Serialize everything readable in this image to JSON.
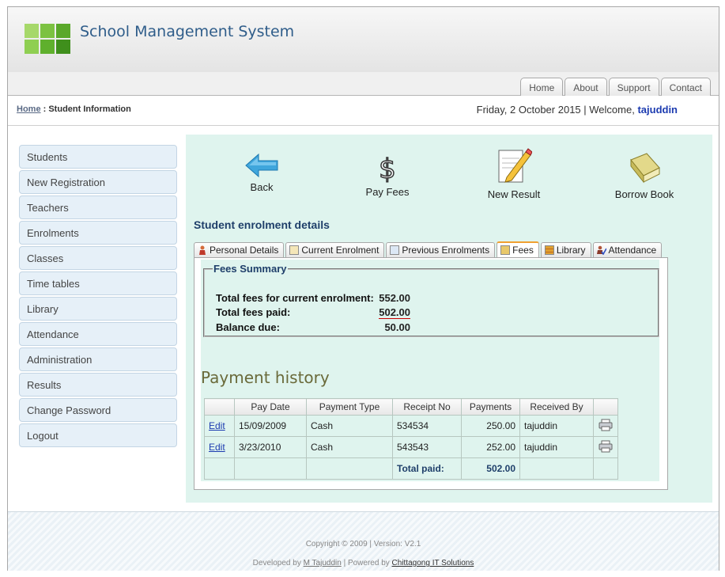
{
  "app": {
    "title": "School Management System"
  },
  "top_nav": [
    "Home",
    "About",
    "Support",
    "Contact"
  ],
  "breadcrumb": {
    "home": "Home",
    "separator": " : ",
    "current": "Student Information"
  },
  "header_info": {
    "date": "Friday, 2 October 2015",
    "separator": " | ",
    "welcome_label": "Welcome,",
    "user": "tajuddin"
  },
  "sidebar": [
    "Students",
    "New Registration",
    "Teachers",
    "Enrolments",
    "Classes",
    "Time tables",
    "Library",
    "Attendance",
    "Administration",
    "Results",
    "Change Password",
    "Logout"
  ],
  "actions": {
    "back": "Back",
    "pay_fees": "Pay Fees",
    "new_result": "New Result",
    "borrow_book": "Borrow Book"
  },
  "section_title": "Student enrolment details",
  "tabs": [
    {
      "label": "Personal Details",
      "icon": "person-icon"
    },
    {
      "label": "Current Enrolment",
      "icon": "form-icon"
    },
    {
      "label": "Previous Enrolments",
      "icon": "form-list-icon"
    },
    {
      "label": "Fees",
      "icon": "money-icon",
      "active": true
    },
    {
      "label": "Library",
      "icon": "books-icon"
    },
    {
      "label": "Attendance",
      "icon": "check-person-icon"
    }
  ],
  "fees_summary": {
    "legend": "Fees Summary",
    "total_label": "Total fees for current enrolment:",
    "total_value": "552.00",
    "paid_label": "Total fees paid:",
    "paid_value": "502.00",
    "balance_label": "Balance due:",
    "balance_value": "50.00"
  },
  "payment_history": {
    "title": "Payment history",
    "columns": [
      "",
      "Pay Date",
      "Payment Type",
      "Receipt No",
      "Payments",
      "Received By",
      ""
    ],
    "rows": [
      {
        "action": "Edit",
        "date": "15/09/2009",
        "type": "Cash",
        "receipt": "534534",
        "amount": "250.00",
        "received_by": "tajuddin"
      },
      {
        "action": "Edit",
        "date": "3/23/2010",
        "type": "Cash",
        "receipt": "543543",
        "amount": "252.00",
        "received_by": "tajuddin"
      }
    ],
    "total_label": "Total paid:",
    "total_value": "502.00"
  },
  "footer": {
    "copyright": "Copyright © 2009 | Version: V2.1",
    "developed_by": "Developed by",
    "developer": "M Tajuddin",
    "powered_by": "| Powered by",
    "company": "Chittagong IT Solutions"
  },
  "colors": {
    "accent": "#2f5d8a",
    "content_bg": "#dff4ee",
    "sidebar_bg": "#e6f0f8",
    "link": "#1c3bb0"
  }
}
